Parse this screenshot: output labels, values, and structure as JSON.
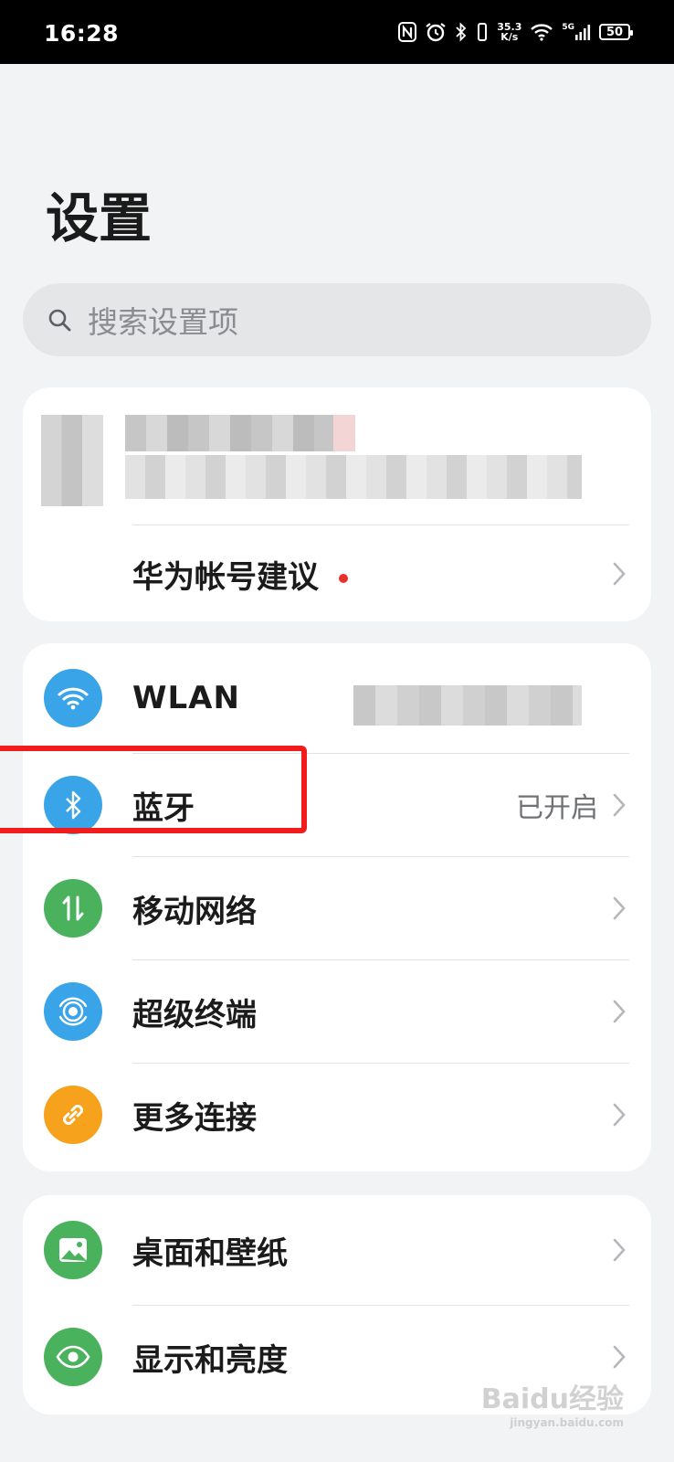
{
  "status_bar": {
    "time": "16:28",
    "net_speed_value": "35.3",
    "net_speed_unit": "K/s",
    "signal_label": "5G",
    "battery": "50",
    "icons": [
      "nfc-icon",
      "alarm-icon",
      "bluetooth-icon",
      "vibrate-icon",
      "wifi-icon",
      "cellular-signal-icon",
      "battery-icon"
    ]
  },
  "page_title": "设置",
  "search": {
    "placeholder": "搜索设置项",
    "icon": "search-icon"
  },
  "account_card": {
    "suggestion_label": "华为帐号建议",
    "has_badge": true
  },
  "connect_card": {
    "items": [
      {
        "label": "WLAN",
        "value": "",
        "icon": "wifi-icon",
        "color": "#3aa4e8"
      },
      {
        "label": "蓝牙",
        "value": "已开启",
        "icon": "bluetooth-icon",
        "color": "#3aa4e8"
      },
      {
        "label": "移动网络",
        "value": "",
        "icon": "mobile-data-icon",
        "color": "#4ab15c"
      },
      {
        "label": "超级终端",
        "value": "",
        "icon": "super-device-icon",
        "color": "#3aa4e8"
      },
      {
        "label": "更多连接",
        "value": "",
        "icon": "link-icon",
        "color": "#f6a21c"
      }
    ]
  },
  "display_card": {
    "items": [
      {
        "label": "桌面和壁纸",
        "icon": "wallpaper-icon",
        "color": "#4ab15c"
      },
      {
        "label": "显示和亮度",
        "icon": "eye-icon",
        "color": "#4ab15c"
      }
    ]
  },
  "watermark": {
    "text": "Baidu经验",
    "sub": "jingyan.baidu.com"
  },
  "colors": {
    "highlight": "#f21c1c",
    "accent_blue": "#3aa4e8",
    "accent_green": "#4ab15c",
    "accent_orange": "#f6a21c",
    "badge_red": "#e8312d"
  }
}
